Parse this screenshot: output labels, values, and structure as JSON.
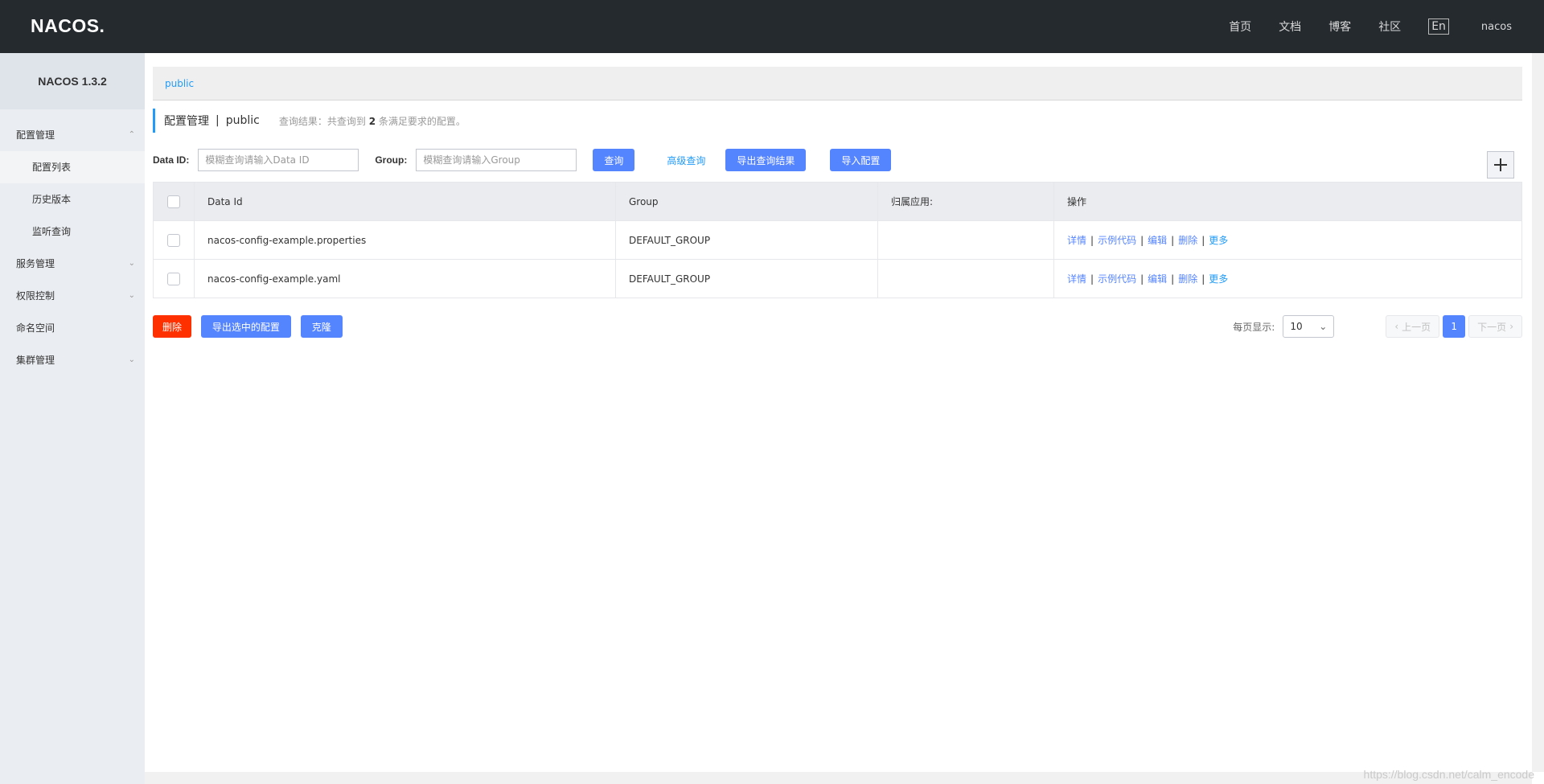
{
  "header": {
    "logo": "NACOS.",
    "nav": [
      "首页",
      "文档",
      "博客",
      "社区"
    ],
    "lang": "En",
    "user": "nacos"
  },
  "sidebar": {
    "version": "NACOS 1.3.2",
    "config_mgmt": "配置管理",
    "config_list": "配置列表",
    "history": "历史版本",
    "listener": "监听查询",
    "service_mgmt": "服务管理",
    "auth": "权限控制",
    "namespace": "命名空间",
    "cluster": "集群管理"
  },
  "namespace_bar": {
    "active": "public"
  },
  "title": {
    "page": "配置管理",
    "separator": "|",
    "namespace": "public",
    "result_prefix": "查询结果：共查询到",
    "result_count": "2",
    "result_suffix": "条满足要求的配置。"
  },
  "search": {
    "dataid_label": "Data ID:",
    "dataid_placeholder": "模糊查询请输入Data ID",
    "group_label": "Group:",
    "group_placeholder": "模糊查询请输入Group",
    "query_btn": "查询",
    "advanced": "高级查询",
    "export_btn": "导出查询结果",
    "import_btn": "导入配置"
  },
  "table": {
    "headers": [
      "Data Id",
      "Group",
      "归属应用:",
      "操作"
    ],
    "rows": [
      {
        "data_id": "nacos-config-example.properties",
        "group": "DEFAULT_GROUP",
        "app": ""
      },
      {
        "data_id": "nacos-config-example.yaml",
        "group": "DEFAULT_GROUP",
        "app": ""
      }
    ],
    "ops": {
      "detail": "详情",
      "sample": "示例代码",
      "edit": "编辑",
      "delete": "删除",
      "more": "更多",
      "sep": "|"
    }
  },
  "bottom": {
    "delete_btn": "删除",
    "export_selected_btn": "导出选中的配置",
    "clone_btn": "克隆"
  },
  "pager": {
    "page_size_label": "每页显示:",
    "page_size": "10",
    "prev": "上一页",
    "current": "1",
    "next": "下一页"
  },
  "watermark": "https://blog.csdn.net/calm_encode",
  "colors": {
    "accent": "#5584ff",
    "link": "#209bfa",
    "danger": "#ff3000",
    "header_bg": "#252a2f"
  }
}
